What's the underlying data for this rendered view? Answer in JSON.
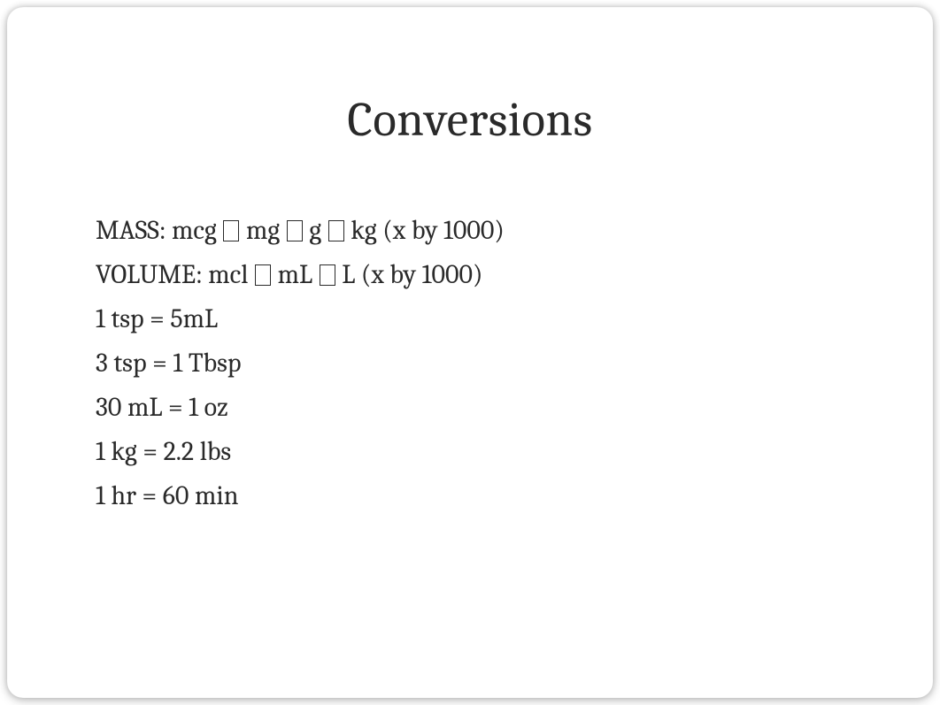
{
  "title": "Conversions",
  "lines": {
    "mass": {
      "prefix": "MASS: mcg ",
      "seg1": " mg ",
      "seg2": " g ",
      "seg3": " kg   (x by 1000)"
    },
    "volume": {
      "prefix": "VOLUME: mcl ",
      "seg1": " mL ",
      "seg2": " L  (x by 1000)"
    },
    "line3": "1 tsp = 5mL",
    "line4": "3 tsp = 1 Tbsp",
    "line5": "30 mL = 1 oz",
    "line6": "1 kg = 2.2 lbs",
    "line7": "1 hr = 60 min"
  }
}
